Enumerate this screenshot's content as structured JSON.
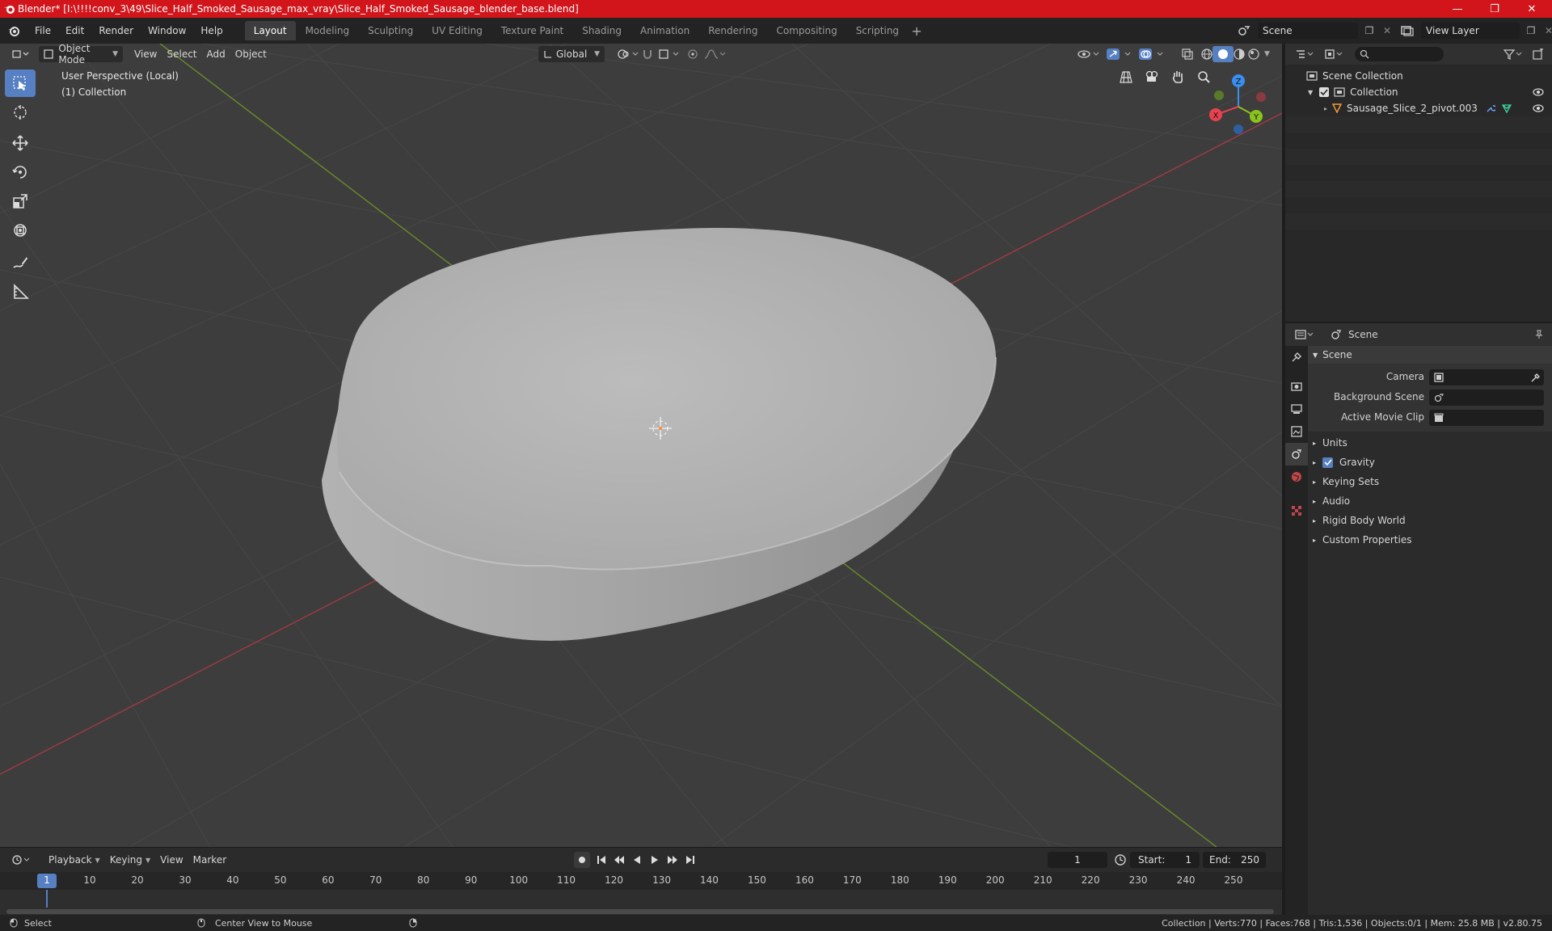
{
  "window": {
    "title": "Blender* [I:\\!!!!conv_3\\49\\Slice_Half_Smoked_Sausage_max_vray\\Slice_Half_Smoked_Sausage_blender_base.blend]"
  },
  "menus": [
    "File",
    "Edit",
    "Render",
    "Window",
    "Help"
  ],
  "workspaces": [
    "Layout",
    "Modeling",
    "Sculpting",
    "UV Editing",
    "Texture Paint",
    "Shading",
    "Animation",
    "Rendering",
    "Compositing",
    "Scripting"
  ],
  "active_workspace": "Layout",
  "scene_selector": {
    "value": "Scene"
  },
  "view_layer_selector": {
    "value": "View Layer"
  },
  "viewport": {
    "mode": "Object Mode",
    "menus": [
      "View",
      "Select",
      "Add",
      "Object"
    ],
    "orientation": "Global",
    "info_line1": "User Perspective (Local)",
    "info_line2": "(1) Collection",
    "gizmo": {
      "x": "X",
      "y": "Y",
      "z": "Z"
    }
  },
  "outliner": {
    "search_placeholder": "",
    "root": "Scene Collection",
    "collection": "Collection",
    "object": "Sausage_Slice_2_pivot.003"
  },
  "properties": {
    "header_title": "Scene",
    "panel_title": "Scene",
    "camera_label": "Camera",
    "background_scene_label": "Background Scene",
    "active_movie_clip_label": "Active Movie Clip",
    "sections": [
      "Units",
      "Gravity",
      "Keying Sets",
      "Audio",
      "Rigid Body World",
      "Custom Properties"
    ],
    "gravity_enabled": true
  },
  "timeline": {
    "menus": [
      "Playback",
      "Keying",
      "View",
      "Marker"
    ],
    "current_frame": "1",
    "start_label": "Start:",
    "start_value": "1",
    "end_label": "End:",
    "end_value": "250",
    "ticks": [
      "1",
      "10",
      "20",
      "30",
      "40",
      "50",
      "60",
      "70",
      "80",
      "90",
      "100",
      "110",
      "120",
      "130",
      "140",
      "150",
      "160",
      "170",
      "180",
      "190",
      "200",
      "210",
      "220",
      "230",
      "240",
      "250"
    ]
  },
  "status": {
    "left_action": "Select",
    "mid_action": "Center View to Mouse",
    "stats": "Collection | Verts:770 | Faces:768 | Tris:1,536 | Objects:0/1 | Mem: 25.8 MB | v2.80.75"
  },
  "colors": {
    "title_bar": "#d1151b",
    "active_tool": "#5680c2",
    "x_axis": "#e8424f",
    "y_axis": "#8bc21d",
    "z_axis": "#3a8ef0"
  }
}
